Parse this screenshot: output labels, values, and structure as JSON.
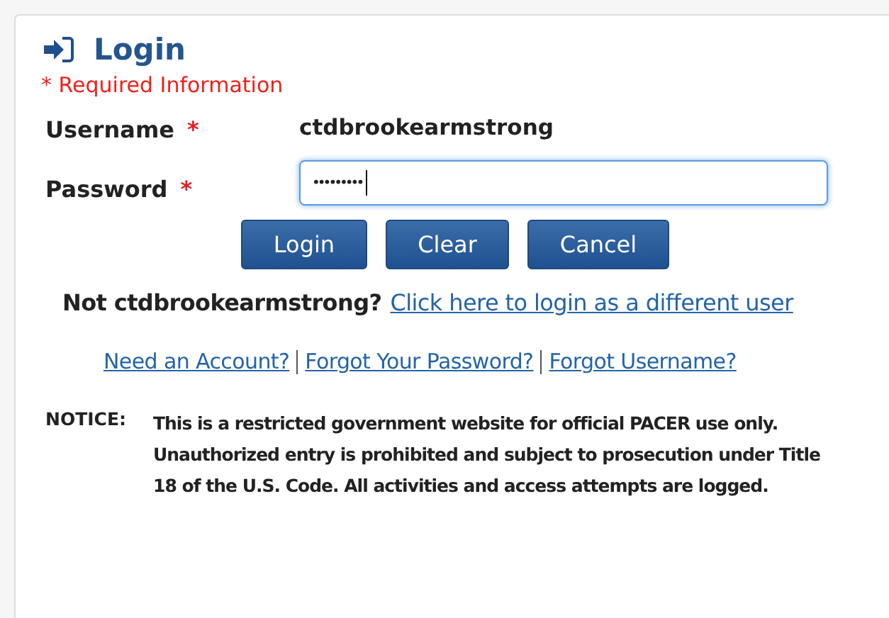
{
  "title": "Login",
  "required_note": "* Required Information",
  "fields": [
    {
      "label": "Username",
      "required_mark": "*",
      "kind": "static",
      "value": "ctdbrookearmstrong"
    },
    {
      "label": "Password",
      "required_mark": "*",
      "kind": "input",
      "value": "•••••••••",
      "focused": true
    }
  ],
  "buttons": [
    "Login",
    "Clear",
    "Cancel"
  ],
  "different_user": {
    "text": "Not ctdbrookearmstrong?",
    "link": "Click here to login as a different user"
  },
  "links": [
    "Need an Account?",
    "Forgot Your Password?",
    "Forgot Username?"
  ],
  "notice": {
    "label": "NOTICE:",
    "text": "This is a restricted government website for official PACER use only. Unauthorized entry is prohibited and subject to prosecution under Title 18 of the U.S. Code. All activities and access attempts are logged."
  }
}
